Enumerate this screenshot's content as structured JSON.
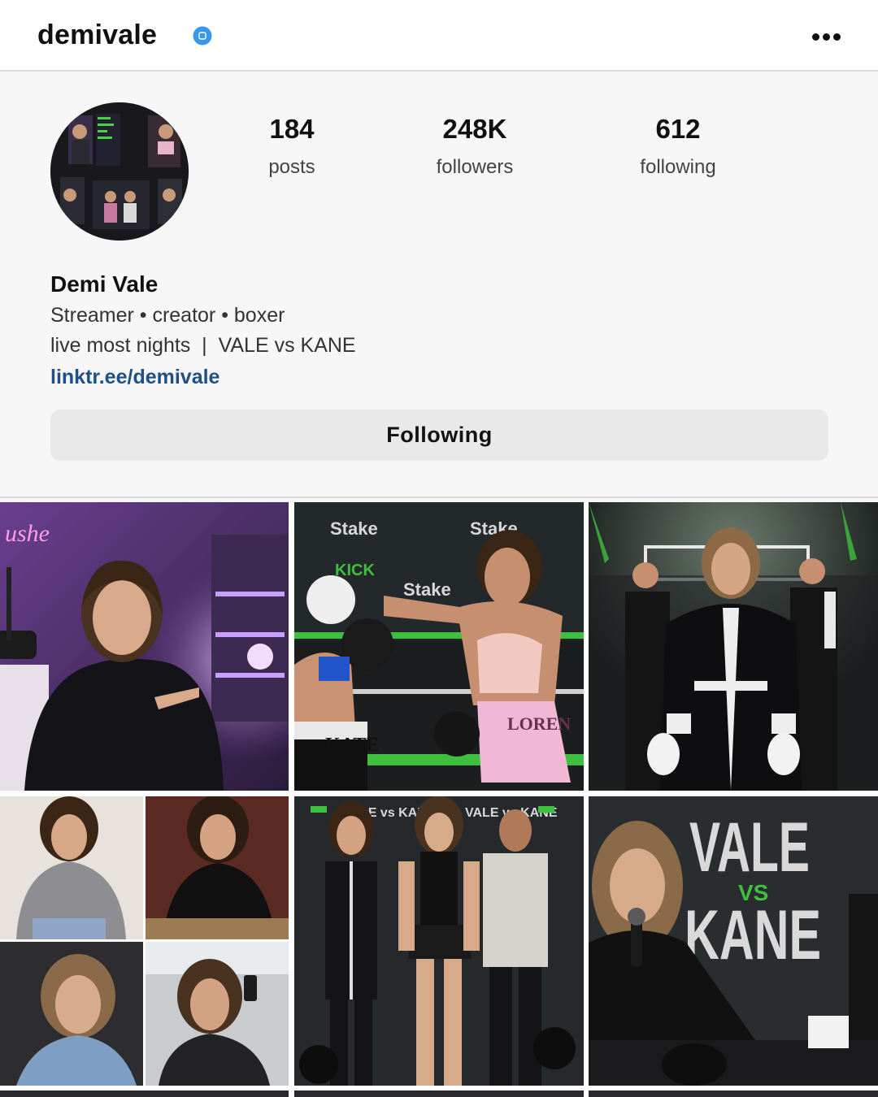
{
  "header": {
    "username": "demivale",
    "verified_icon": "verified-badge-icon",
    "more_icon": "more-options-icon"
  },
  "profile": {
    "stats": [
      {
        "value": "184",
        "label": "posts"
      },
      {
        "value": "248K",
        "label": "followers"
      },
      {
        "value": "612",
        "label": "following"
      }
    ],
    "full_name": "Demi Vale",
    "bio_line1": "Streamer • creator • boxer",
    "bio_line2": "live most nights  |  VALE vs KANE",
    "link": "linktr.ee/demivale",
    "follow_button": "Following"
  },
  "posts": [
    {
      "scene": "streaming-room-selfie",
      "signs": [
        "ushe"
      ]
    },
    {
      "scene": "boxing-match-punch",
      "signs": [
        "Stake",
        "KICK",
        "KATE",
        "LOREN"
      ]
    },
    {
      "scene": "ring-walk-robe",
      "signs": []
    },
    {
      "scene": "photo-collage-four",
      "signs": []
    },
    {
      "scene": "face-off-press-event",
      "signs": [
        "VALE vs KANE"
      ]
    },
    {
      "scene": "press-conference-mic",
      "signs": [
        "VALE",
        "VS",
        "KANE"
      ]
    }
  ],
  "colors": {
    "accent_blue": "#3897f0",
    "link_blue": "#1e4f86",
    "button_gray": "#e9e9e9",
    "neon_purple": "#a35bd6",
    "kick_green": "#3fbf3f"
  }
}
